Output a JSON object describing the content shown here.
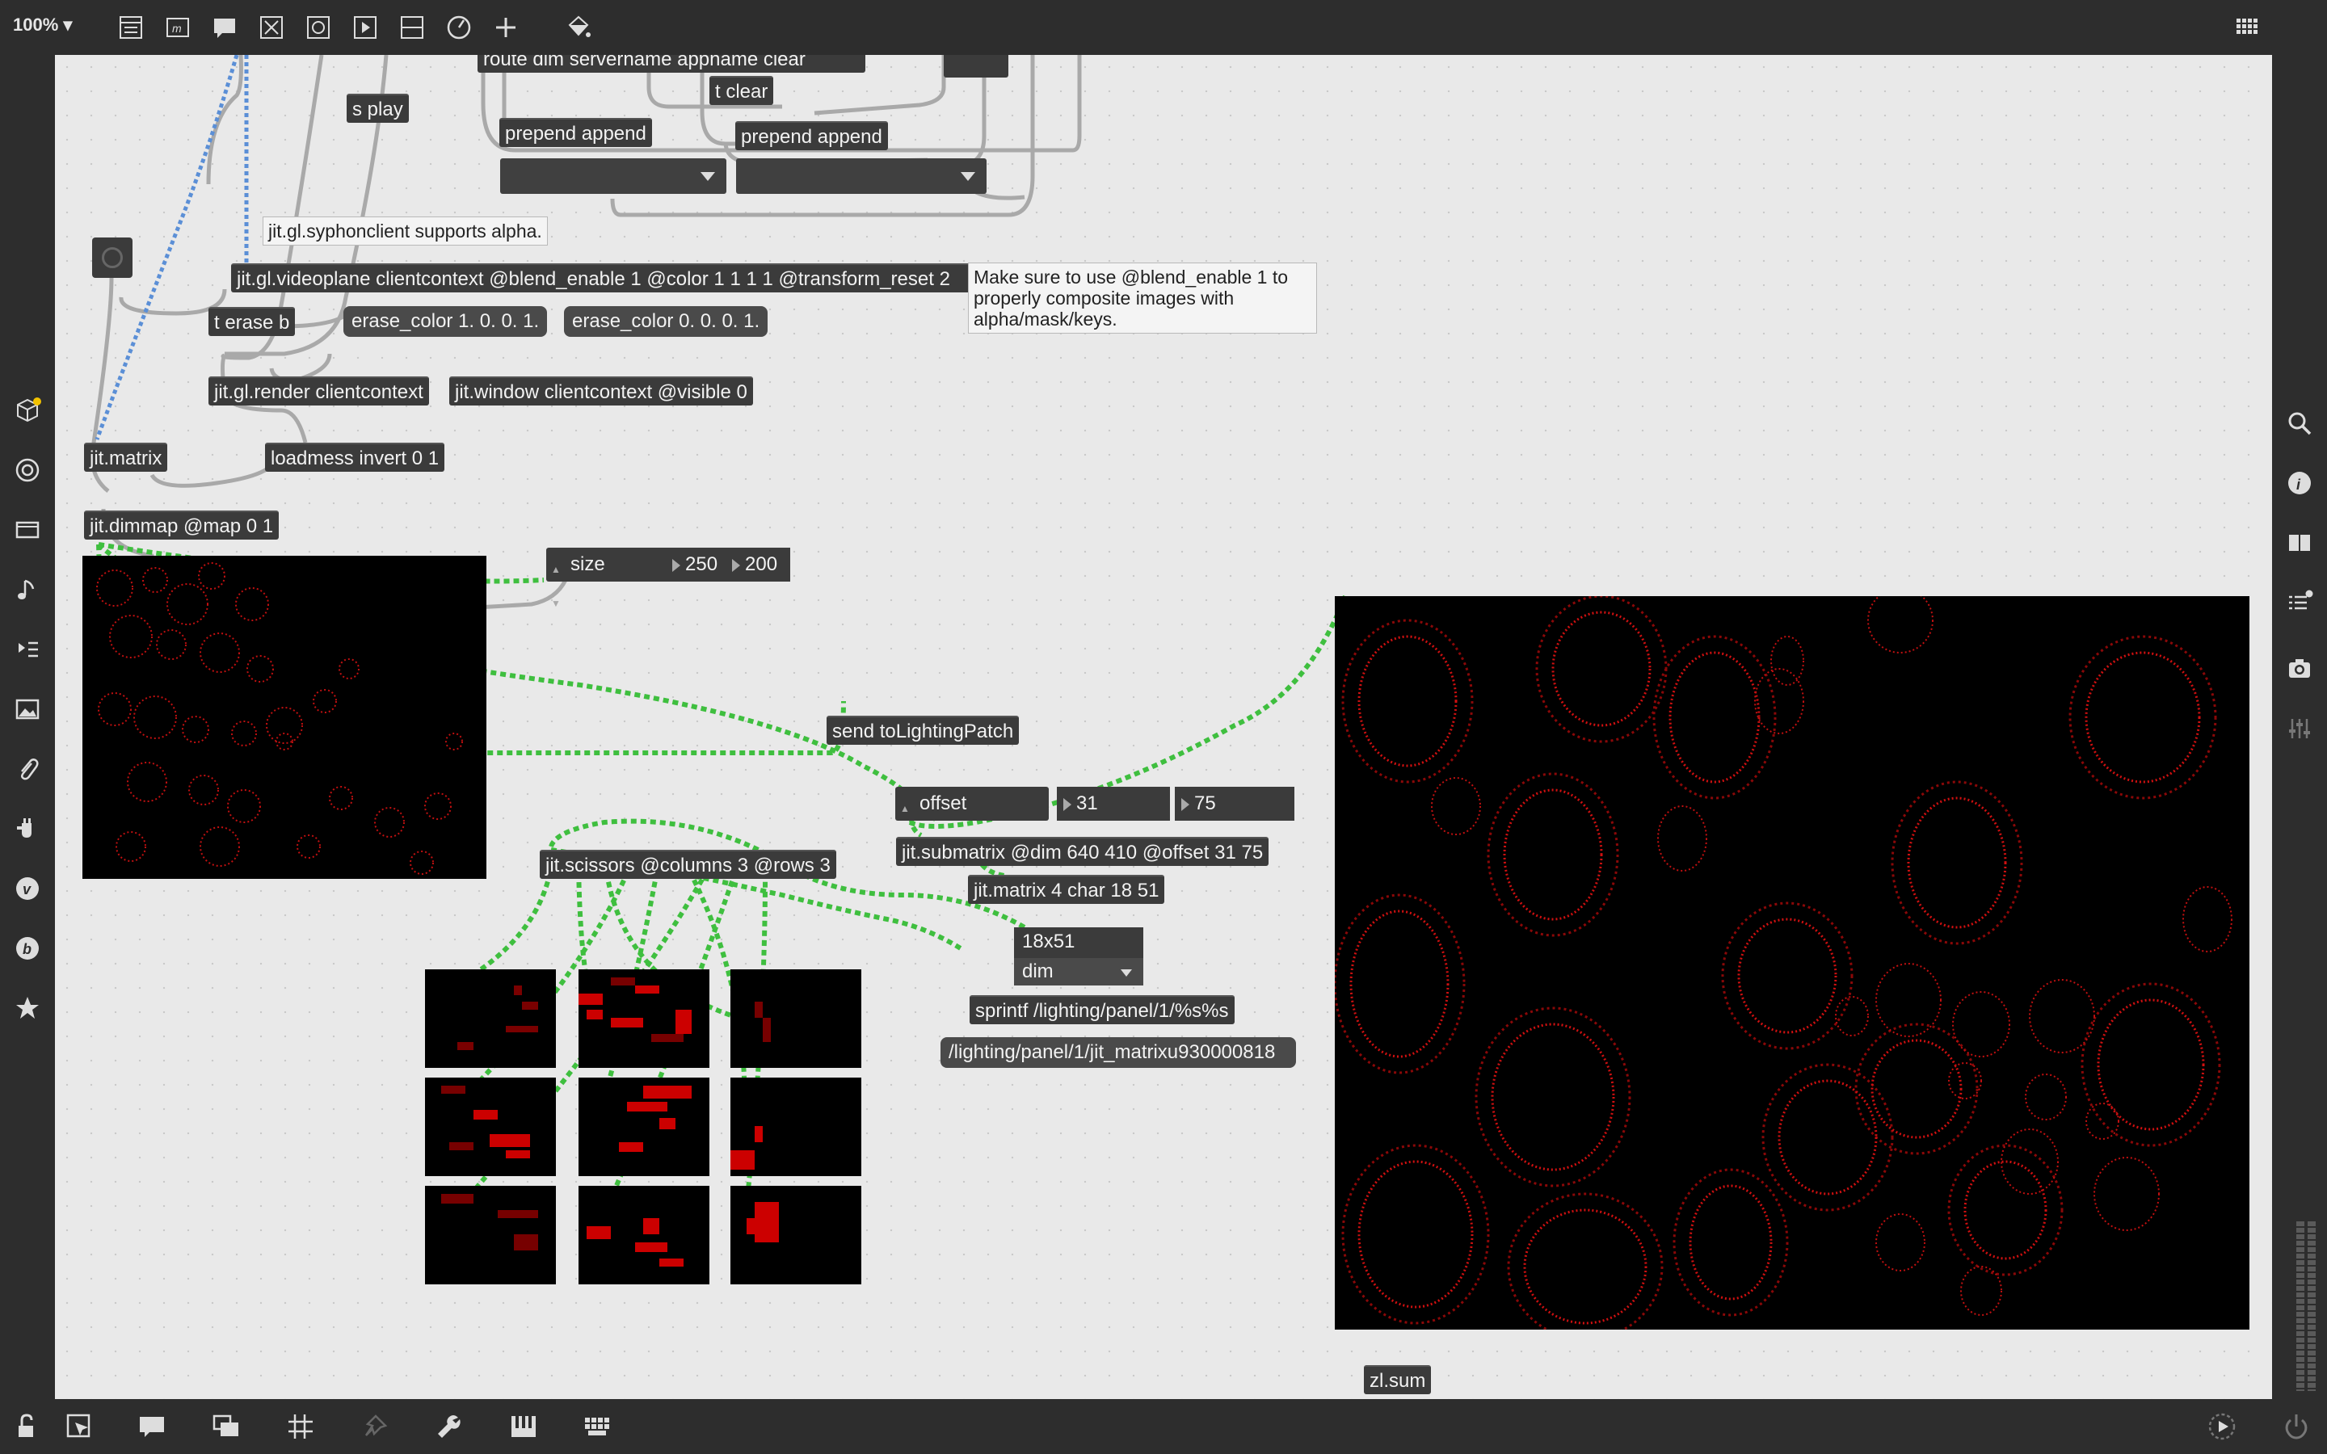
{
  "toolbar": {
    "zoom": "100%",
    "icons": [
      "presentation-icon",
      "object-icon",
      "comment-icon",
      "toggle-x-icon",
      "button-icon",
      "play-icon",
      "slider-icon",
      "dial-icon",
      "plus-icon",
      "paint-icon"
    ],
    "grid_icon": "grid-icon"
  },
  "left_sidebar": {
    "icons": [
      "cube-icon",
      "target-icon",
      "media-icon",
      "note-icon",
      "play-list-icon",
      "image-icon",
      "clip-icon",
      "plug-icon",
      "v-icon",
      "b-icon",
      "star-icon"
    ]
  },
  "right_sidebar": {
    "icons": [
      "search-icon",
      "info-icon",
      "book-icon",
      "list-icon",
      "camera-icon",
      "mixer-icon"
    ]
  },
  "bottom_bar": {
    "icons": [
      "lock-icon",
      "cursor-icon",
      "comment-icon",
      "windows-icon",
      "grid-icon",
      "pin-icon",
      "wrench-icon",
      "piano-icon",
      "keyboard-icon"
    ],
    "right_icons": [
      "transport-icon",
      "power-icon"
    ]
  },
  "patch": {
    "objects": {
      "route_dim": "route dim servername appname clear",
      "t_clear": "t clear",
      "s_play": "s play",
      "prepend_append_1": "prepend append",
      "prepend_append_2": "prepend append",
      "videoplane": "jit.gl.videoplane clientcontext @blend_enable 1 @color 1 1 1 1 @transform_reset 2",
      "t_erase": "t erase b",
      "erase_color_red": "erase_color 1. 0. 0. 1.",
      "erase_color_black": "erase_color 0. 0. 0. 1.",
      "gl_render": "jit.gl.render clientcontext",
      "jit_window": "jit.window clientcontext @visible 0",
      "jit_matrix": "jit.matrix",
      "loadmess": "loadmess invert 0 1",
      "dimmap": "jit.dimmap @map 0 1",
      "send": "send toLightingPatch",
      "scissors": "jit.scissors @columns 3 @rows 3",
      "submatrix": "jit.submatrix @dim 640 410 @offset 31 75",
      "matrix_char": "jit.matrix 4 char 18 51",
      "sprintf": "sprintf /lighting/panel/1/%s%s",
      "zl_sum": "zl.sum"
    },
    "comments": {
      "syphon": "jit.gl.syphonclient supports alpha.",
      "blend": "Make sure to use @blend_enable 1 to properly composite images with alpha/mask/keys."
    },
    "attrui": {
      "size_label": "size",
      "size_w": "250",
      "size_h": "200",
      "offset_label": "offset",
      "offset_x": "31",
      "offset_y": "75"
    },
    "dim_display": {
      "value": "18x51",
      "menu": "dim"
    },
    "message_output": "/lighting/panel/1/jit_matrixu930000818",
    "accent_color": "#3fbf3f",
    "patchcord_color": "#a9a9a9",
    "matrix_color": "#5b8fd6"
  }
}
